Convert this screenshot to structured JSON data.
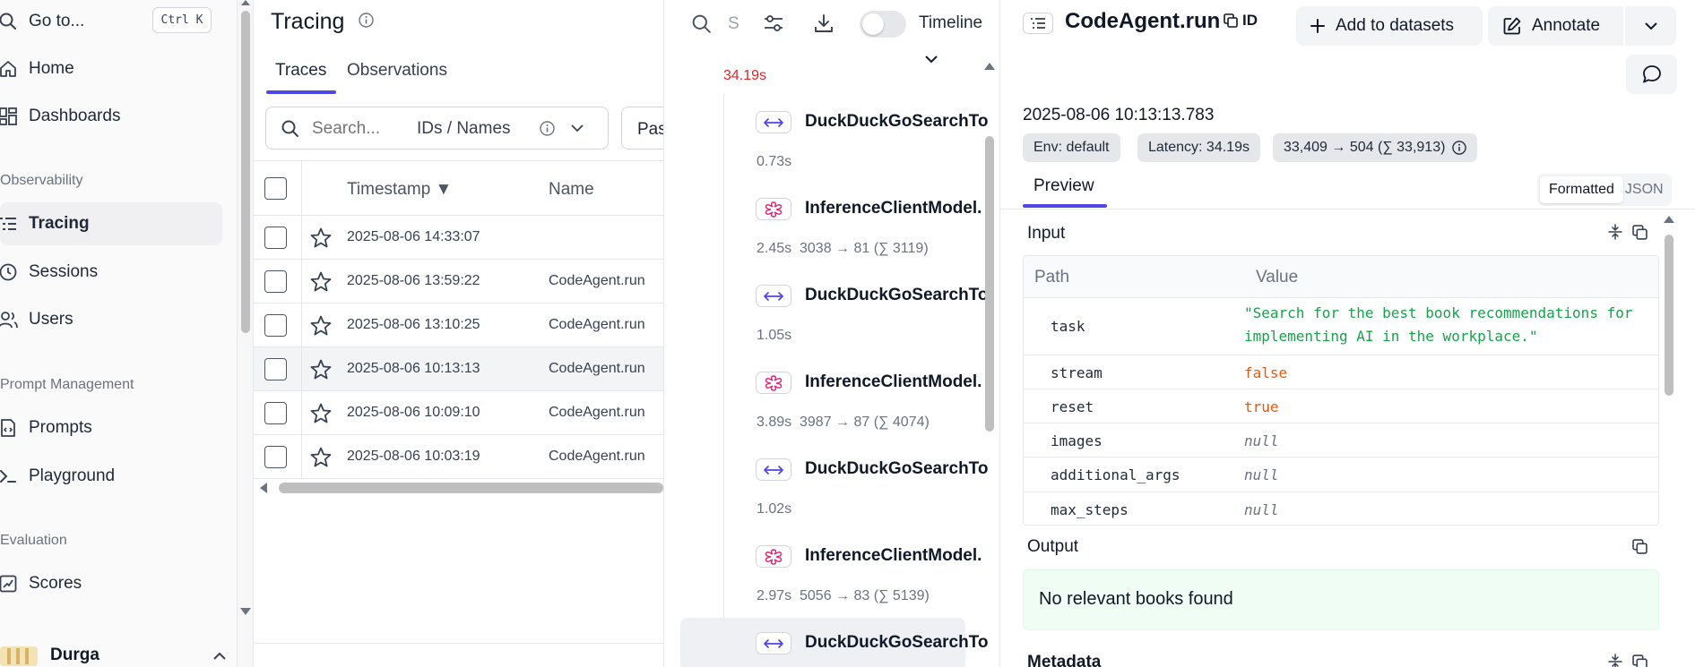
{
  "sidebar": {
    "goto_label": "Go to...",
    "goto_shortcut": "Ctrl K",
    "items": [
      {
        "label": "Home",
        "icon": "home-icon"
      },
      {
        "label": "Dashboards",
        "icon": "dashboard-icon"
      }
    ],
    "sections": {
      "observability": {
        "title": "Observability",
        "items": [
          {
            "label": "Tracing",
            "icon": "tracing-icon",
            "active": true
          },
          {
            "label": "Sessions",
            "icon": "clock-icon"
          },
          {
            "label": "Users",
            "icon": "users-icon"
          }
        ]
      },
      "prompt_management": {
        "title": "Prompt Management",
        "items": [
          {
            "label": "Prompts",
            "icon": "file-code-icon"
          },
          {
            "label": "Playground",
            "icon": "terminal-icon"
          }
        ]
      },
      "evaluation": {
        "title": "Evaluation",
        "items": [
          {
            "label": "Scores",
            "icon": "scores-icon"
          }
        ]
      }
    },
    "user_name": "Durga"
  },
  "tracing": {
    "title": "Tracing",
    "tabs": [
      {
        "label": "Traces",
        "active": true
      },
      {
        "label": "Observations",
        "active": false
      }
    ],
    "search_placeholder": "Search...",
    "search_mode": "IDs / Names",
    "filter_button_partial": "Pas",
    "columns": {
      "timestamp": "Timestamp ▼",
      "name": "Name"
    },
    "rows": [
      {
        "timestamp": "2025-08-06 14:33:07",
        "name": ""
      },
      {
        "timestamp": "2025-08-06 13:59:22",
        "name": "CodeAgent.run"
      },
      {
        "timestamp": "2025-08-06 13:10:25",
        "name": "CodeAgent.run"
      },
      {
        "timestamp": "2025-08-06 10:13:13",
        "name": "CodeAgent.run"
      },
      {
        "timestamp": "2025-08-06 10:09:10",
        "name": "CodeAgent.run"
      },
      {
        "timestamp": "2025-08-06 10:03:19",
        "name": "CodeAgent.run"
      }
    ]
  },
  "tree": {
    "search_partial": "S",
    "timeline_label": "Timeline",
    "root_latency": "34.19s",
    "root_latency_color": "#dc2626",
    "nodes": [
      {
        "type": "tool",
        "title": "DuckDuckGoSearchTo",
        "latency": "0.73s",
        "tokens": ""
      },
      {
        "type": "generation",
        "title": "InferenceClientModel.",
        "latency": "2.45s",
        "tokens": "3038 → 81 (∑ 3119)"
      },
      {
        "type": "tool",
        "title": "DuckDuckGoSearchTo",
        "latency": "1.05s",
        "tokens": ""
      },
      {
        "type": "generation",
        "title": "InferenceClientModel.",
        "latency": "3.89s",
        "tokens": "3987 → 87 (∑ 4074)"
      },
      {
        "type": "tool",
        "title": "DuckDuckGoSearchTo",
        "latency": "1.02s",
        "tokens": ""
      },
      {
        "type": "generation",
        "title": "InferenceClientModel.",
        "latency": "2.97s",
        "tokens": "5056 → 83 (∑ 5139)"
      },
      {
        "type": "tool",
        "title": "DuckDuckGoSearchTo",
        "latency": "",
        "tokens": ""
      }
    ]
  },
  "detail": {
    "title": "CodeAgent.run",
    "id_label": "ID",
    "add_to_datasets": "Add to datasets",
    "annotate": "Annotate",
    "timestamp": "2025-08-06 10:13:13.783",
    "badges": {
      "env": "Env: default",
      "latency": "Latency: 34.19s",
      "tokens": "33,409 → 504 (∑ 33,913)"
    },
    "tab_preview": "Preview",
    "view_formatted": "Formatted",
    "view_json": "JSON",
    "input_title": "Input",
    "col_path": "Path",
    "col_value": "Value",
    "input_rows": [
      {
        "key": "task",
        "value": "\"Search for the best book recommendations for",
        "value2": "implementing AI in the workplace.\"",
        "kind": "string"
      },
      {
        "key": "stream",
        "value": "false",
        "kind": "bool"
      },
      {
        "key": "reset",
        "value": "true",
        "kind": "bool"
      },
      {
        "key": "images",
        "value": "null",
        "kind": "null"
      },
      {
        "key": "additional_args",
        "value": "null",
        "kind": "null"
      },
      {
        "key": "max_steps",
        "value": "null",
        "kind": "null"
      }
    ],
    "output_title": "Output",
    "output_text": "No relevant books found",
    "metadata_title": "Metadata"
  },
  "colors": {
    "accent": "#4f46e5",
    "tool_icon": "#4f46e5",
    "generation_icon": "#db2777",
    "string_value": "#16a34a",
    "bool_value": "#ea580c"
  }
}
